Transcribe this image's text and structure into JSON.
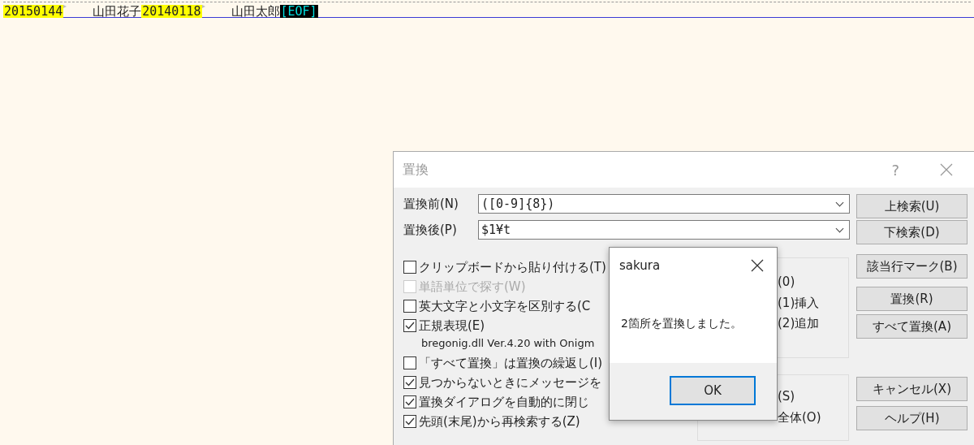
{
  "editor": {
    "line": [
      {
        "kind": "match",
        "text": "20150144"
      },
      {
        "kind": "tab"
      },
      {
        "kind": "plain",
        "text": "山田花子"
      },
      {
        "kind": "match",
        "text": "20140118"
      },
      {
        "kind": "tab"
      },
      {
        "kind": "plain",
        "text": "山田太郎"
      },
      {
        "kind": "eof",
        "text": "[EOF]"
      }
    ]
  },
  "dialog": {
    "title": "置換",
    "help": "?",
    "fields": [
      {
        "label": "置換前(N)",
        "value": "([0-9]{8})"
      },
      {
        "label": "置換後(P)",
        "value": "$1¥t"
      }
    ],
    "options": [
      {
        "kind": "checkbox",
        "label": "クリップボードから貼り付ける(T)",
        "checked": false,
        "disabled": false
      },
      {
        "kind": "checkbox",
        "label": "単語単位で探す(W)",
        "checked": false,
        "disabled": true
      },
      {
        "kind": "checkbox",
        "label": "英大文字と小文字を区別する(C",
        "checked": false,
        "disabled": false
      },
      {
        "kind": "checkbox",
        "label": "正規表現(E)",
        "checked": true,
        "disabled": false
      },
      {
        "kind": "note",
        "label": "bregonig.dll Ver.4.20 with Onigm"
      },
      {
        "kind": "checkbox",
        "label": "「すべて置換」は置換の繰返し(I)",
        "checked": false,
        "disabled": false
      },
      {
        "kind": "checkbox",
        "label": "見つからないときにメッセージを",
        "checked": true,
        "disabled": false
      },
      {
        "kind": "checkbox",
        "label": "置換ダイアログを自動的に閉じ",
        "checked": true,
        "disabled": false
      },
      {
        "kind": "checkbox",
        "label": "先頭(末尾)から再検索する(Z)",
        "checked": true,
        "disabled": false
      }
    ],
    "group_1": [
      "(0)",
      "(1)挿入",
      "(2)追加"
    ],
    "group_2": [
      "(S)",
      "全体(O)"
    ],
    "buttons_top": [
      "上検索(U)",
      "下検索(D)",
      "該当行マーク(B)"
    ],
    "buttons_mid": [
      "置換(R)",
      "すべて置換(A)"
    ],
    "buttons_bottom": [
      "キャンセル(X)",
      "ヘルプ(H)"
    ]
  },
  "message_box": {
    "title": "sakura",
    "text": "2箇所を置換しました。",
    "button": "OK"
  }
}
